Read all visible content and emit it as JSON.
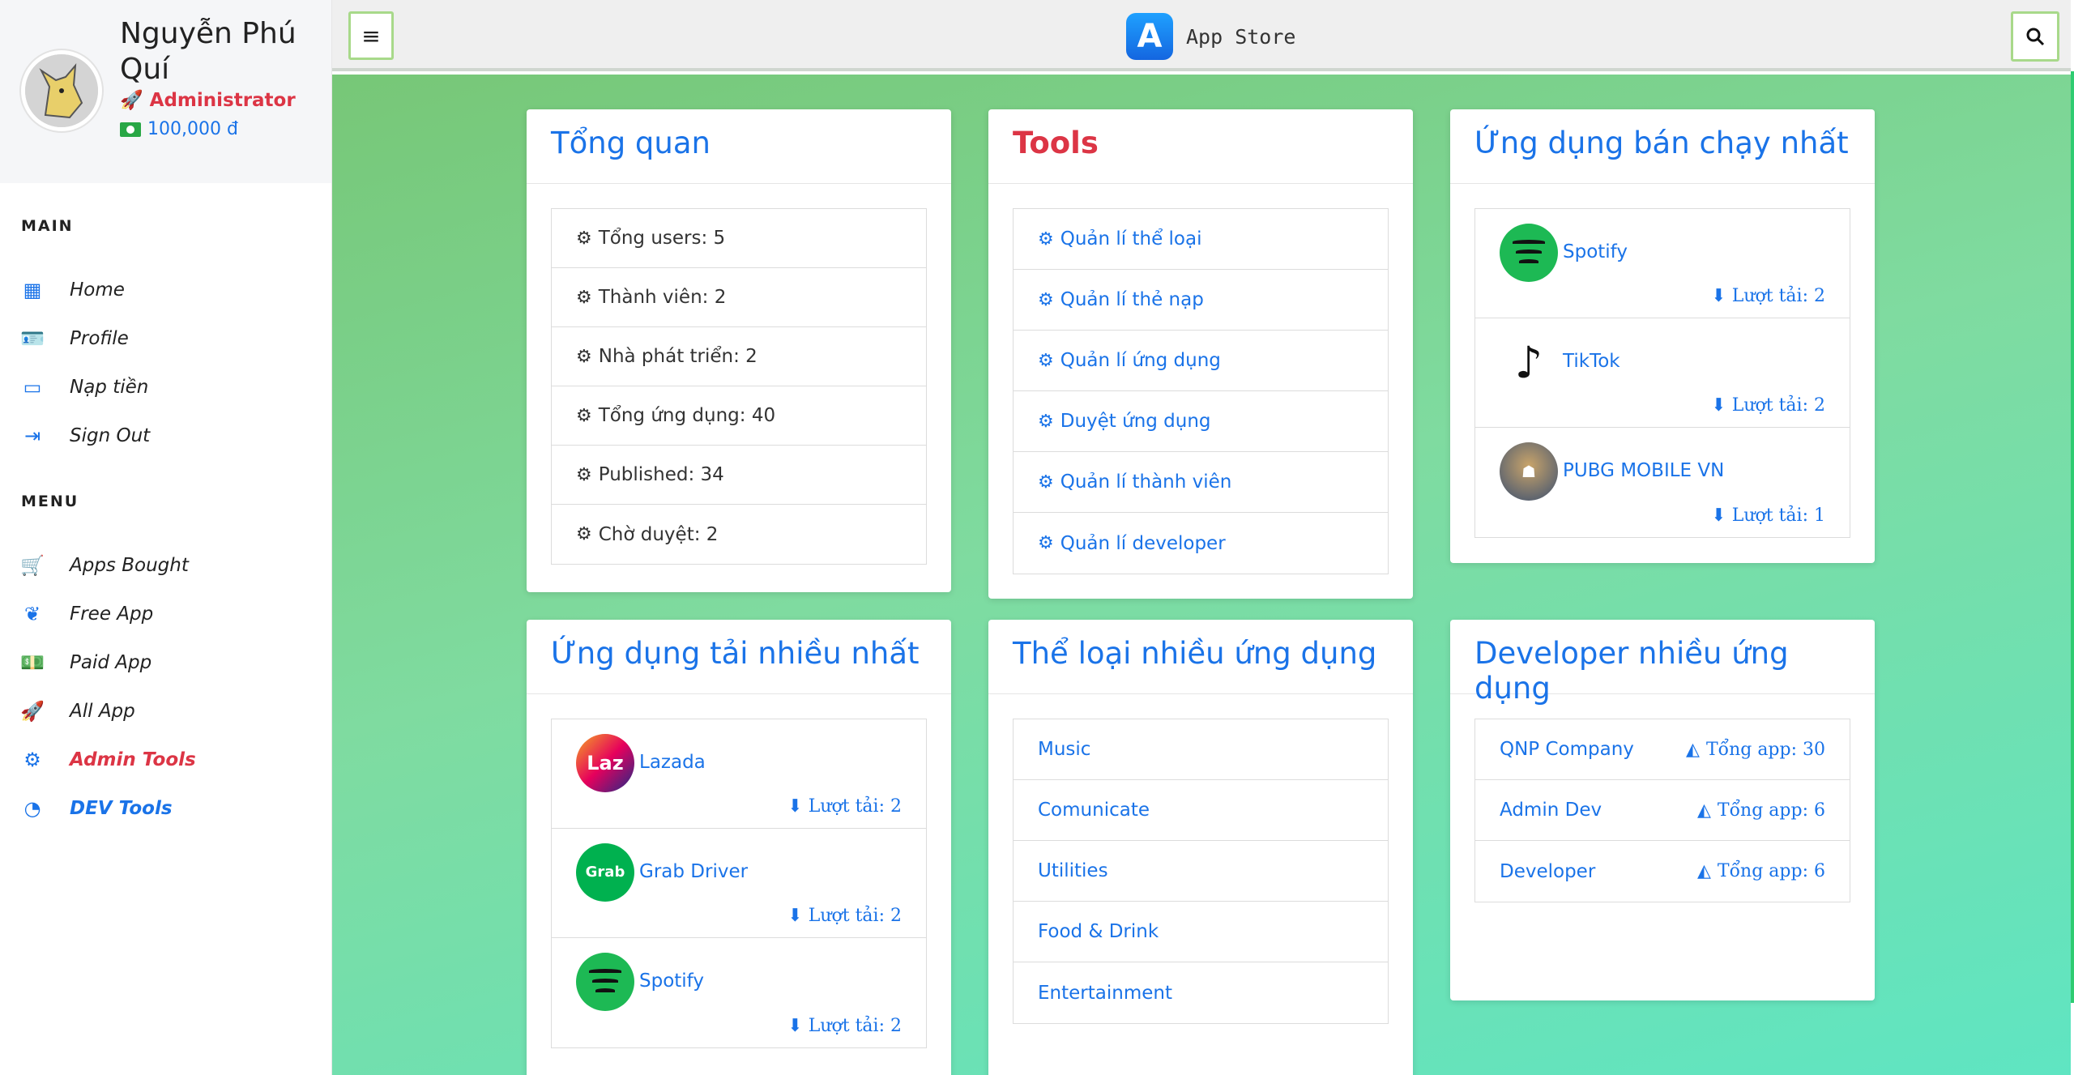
{
  "user": {
    "name": "Nguyễn Phú Quí",
    "role": "Administrator",
    "balance": "100,000 đ"
  },
  "sidebar": {
    "main_title": "MAIN",
    "main_items": [
      {
        "label": "Home",
        "icon": "grid-icon"
      },
      {
        "label": "Profile",
        "icon": "id-card-icon"
      },
      {
        "label": "Nạp tiền",
        "icon": "credit-card-icon"
      },
      {
        "label": "Sign Out",
        "icon": "sign-out-icon"
      }
    ],
    "menu_title": "MENU",
    "menu_items": [
      {
        "label": "Apps Bought",
        "icon": "cart-icon"
      },
      {
        "label": "Free App",
        "icon": "leaf-icon"
      },
      {
        "label": "Paid App",
        "icon": "money-icon"
      },
      {
        "label": "All App",
        "icon": "rocket-icon"
      },
      {
        "label": "Admin Tools",
        "icon": "gears-icon"
      },
      {
        "label": "DEV Tools",
        "icon": "pie-chart-icon"
      }
    ]
  },
  "topbar": {
    "brand": "App Store"
  },
  "overview": {
    "title": "Tổng quan",
    "stats": [
      "Tổng users: 5",
      "Thành viên: 2",
      "Nhà phát triển: 2",
      "Tổng ứng dụng: 40",
      "Published: 34",
      "Chờ duyệt: 2"
    ]
  },
  "tools": {
    "title": "Tools",
    "items": [
      "Quản lí thể loại",
      "Quản lí thẻ nạp",
      "Quản lí ứng dụng",
      "Duyệt ứng dụng",
      "Quản lí thành viên",
      "Quản lí developer"
    ]
  },
  "bestsellers": {
    "title": "Ứng dụng bán chạy nhất",
    "apps": [
      {
        "name": "Spotify",
        "downloads": "Lượt tải: 2"
      },
      {
        "name": "TikTok",
        "downloads": "Lượt tải: 2"
      },
      {
        "name": "PUBG MOBILE VN",
        "downloads": "Lượt tải: 1"
      }
    ]
  },
  "most_downloaded": {
    "title": "Ứng dụng tải nhiều nhất",
    "apps": [
      {
        "name": "Lazada",
        "downloads": "Lượt tải: 2",
        "icon_text": "Laz"
      },
      {
        "name": "Grab Driver",
        "downloads": "Lượt tải: 2",
        "icon_text": "Grab"
      },
      {
        "name": "Spotify",
        "downloads": "Lượt tải: 2"
      }
    ]
  },
  "categories": {
    "title": "Thể loại nhiều ứng dụng",
    "items": [
      "Music",
      "Comunicate",
      "Utilities",
      "Food & Drink",
      "Entertainment"
    ]
  },
  "developers": {
    "title": "Developer nhiều ứng dụng",
    "items": [
      {
        "name": "QNP Company",
        "count": "Tổng app: 30"
      },
      {
        "name": "Admin Dev",
        "count": "Tổng app: 6"
      },
      {
        "name": "Developer",
        "count": "Tổng app: 6"
      }
    ]
  },
  "colors": {
    "accent": "#1a73e8",
    "danger": "#dc3545",
    "success": "#28a745"
  }
}
